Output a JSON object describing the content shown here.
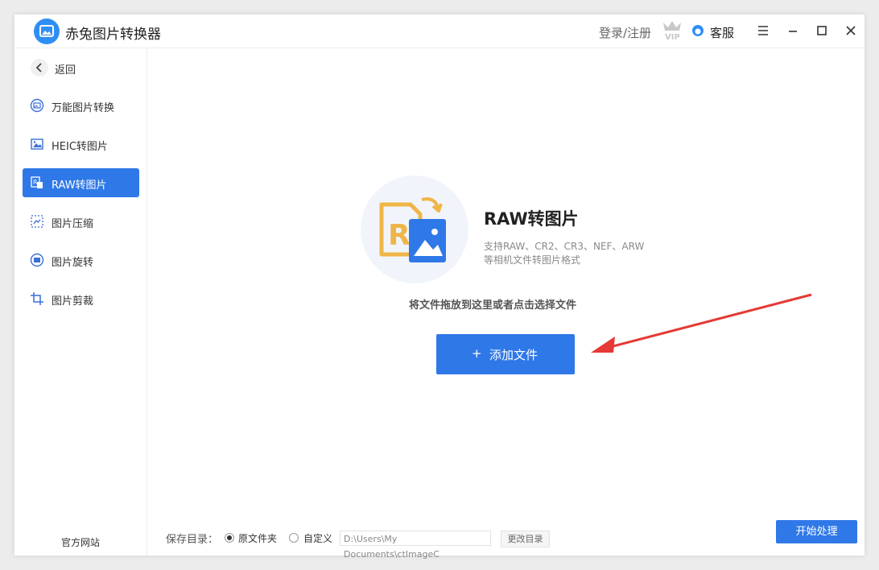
{
  "app": {
    "title": "赤兔图片转换器"
  },
  "header": {
    "login": "登录/注册",
    "service": "客服"
  },
  "sidebar": {
    "back": "返回",
    "items": [
      {
        "label": "万能图片转换",
        "icon": "universal-convert-icon"
      },
      {
        "label": "HEIC转图片",
        "icon": "heic-image-icon"
      },
      {
        "label": "RAW转图片",
        "icon": "raw-image-icon",
        "active": true
      },
      {
        "label": "图片压缩",
        "icon": "compress-icon"
      },
      {
        "label": "图片旋转",
        "icon": "rotate-icon"
      },
      {
        "label": "图片剪裁",
        "icon": "crop-icon"
      }
    ],
    "official": "官方网站"
  },
  "main": {
    "title": "RAW转图片",
    "desc_line1": "支持RAW、CR2、CR3、NEF、ARW",
    "desc_line2": "等相机文件转图片格式",
    "drop_hint": "将文件拖放到这里或者点击选择文件",
    "add_plus": "+",
    "add_button": "添加文件"
  },
  "footer": {
    "save_label": "保存目录：",
    "option_original": "原文件夹",
    "option_custom": "自定义",
    "path": "D:\\Users\\My Documents\\ctImageC",
    "change_dir": "更改目录",
    "start": "开始处理"
  },
  "colors": {
    "accent": "#2f78e8",
    "arrow": "#e53935",
    "raw_badge": "#f0b548"
  }
}
